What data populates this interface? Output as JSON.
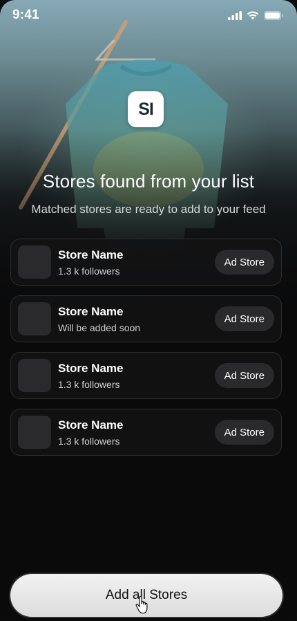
{
  "status_bar": {
    "time": "9:41"
  },
  "logo": {
    "text": "SI"
  },
  "header": {
    "title": "Stores found from your list",
    "subtitle": "Matched stores are ready to add to your feed"
  },
  "stores": [
    {
      "name": "Store Name",
      "meta": "1.3 k followers",
      "button": "Ad Store"
    },
    {
      "name": "Store Name",
      "meta": "Will be added soon",
      "button": "Ad Store"
    },
    {
      "name": "Store Name",
      "meta": "1.3 k followers",
      "button": "Ad Store"
    },
    {
      "name": "Store Name",
      "meta": "1.3 k followers",
      "button": "Ad Store"
    }
  ],
  "cta": {
    "label": "Add all Stores"
  },
  "icons": {
    "status": [
      "signal-icon",
      "wifi-icon",
      "battery-icon"
    ],
    "cursor": "hand-cursor-icon"
  },
  "colors": {
    "background": "#0a0a0b",
    "card": "#121214",
    "button": "#2a2a2c",
    "cta": "#e6e6e6"
  }
}
